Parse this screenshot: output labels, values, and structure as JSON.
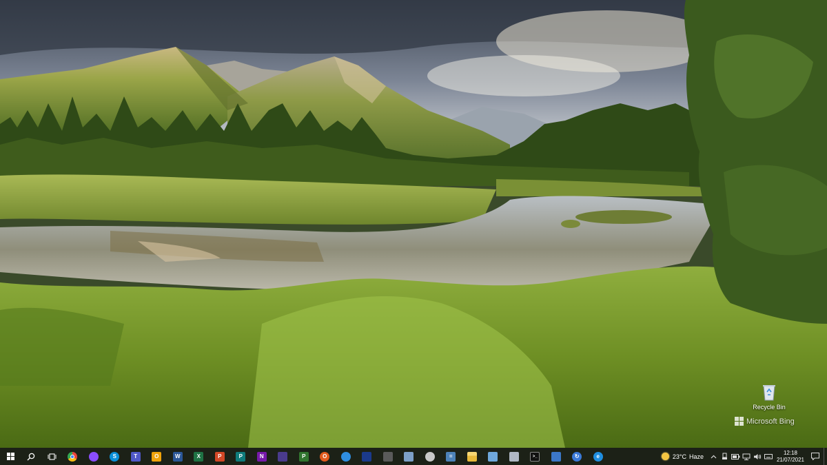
{
  "desktop": {
    "icons": [
      {
        "label": "Recycle Bin",
        "icon": "recycle-bin-icon"
      }
    ],
    "watermark": "Microsoft Bing"
  },
  "taskbar": {
    "start": {
      "icon": "windows-start-icon"
    },
    "search": {
      "icon": "search-icon"
    },
    "task_view": {
      "icon": "task-view-icon"
    },
    "apps": [
      {
        "icon": "chrome-icon",
        "color": "#e8453c"
      },
      {
        "icon": "messenger-icon",
        "color": "#8a4dfd"
      },
      {
        "icon": "skype-icon",
        "color": "#0a8fd8"
      },
      {
        "icon": "teams-icon",
        "color": "#5059c9"
      },
      {
        "icon": "outlook-icon",
        "color": "#f0a30a"
      },
      {
        "icon": "word-icon",
        "color": "#2b5797"
      },
      {
        "icon": "excel-icon",
        "color": "#1f7244"
      },
      {
        "icon": "powerpoint-icon",
        "color": "#d24726"
      },
      {
        "icon": "publisher-icon",
        "color": "#0f7b7b"
      },
      {
        "icon": "onenote-icon",
        "color": "#7719aa"
      },
      {
        "icon": "3d-viewer-icon",
        "color": "#4a3b8c"
      },
      {
        "icon": "project-icon",
        "color": "#31752f"
      },
      {
        "icon": "office-icon",
        "color": "#e25a1c"
      },
      {
        "icon": "ie-dev-icon",
        "color": "#2f8ee0"
      },
      {
        "icon": "powershell-ise-icon",
        "color": "#1b3a8c"
      },
      {
        "icon": "snipping-tool-icon",
        "color": "#5a5a5a"
      },
      {
        "icon": "notepad-icon",
        "color": "#7da0c8"
      },
      {
        "icon": "paint-icon",
        "color": "#c8c8c8"
      },
      {
        "icon": "calculator-icon",
        "color": "#4d82b8"
      },
      {
        "icon": "file-explorer-icon",
        "color": "#f7c945"
      },
      {
        "icon": "settings-app-icon",
        "color": "#6fa8dc"
      },
      {
        "icon": "network-drive-icon",
        "color": "#b0b8c4"
      },
      {
        "icon": "command-prompt-icon",
        "color": "#111111"
      },
      {
        "icon": "remote-desktop-icon",
        "color": "#3c78c8"
      },
      {
        "icon": "sync-icon",
        "color": "#3a79d8"
      },
      {
        "icon": "edge-legacy-icon",
        "color": "#1f8ee0"
      }
    ],
    "weather": {
      "temperature": "23°C",
      "condition": "Haze"
    },
    "tray_icons": [
      "chevron-up-icon",
      "usb-icon",
      "battery-icon",
      "network-icon",
      "volume-icon",
      "keyboard-icon"
    ],
    "clock": {
      "time": "12:18",
      "date": "21/07/2021"
    },
    "notifications": {
      "icon": "notification-icon"
    }
  }
}
